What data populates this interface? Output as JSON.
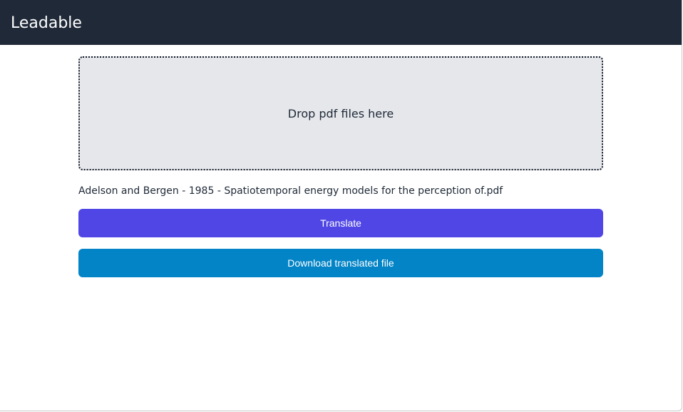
{
  "app": {
    "title": "Leadable"
  },
  "dropzone": {
    "label": "Drop pdf files here"
  },
  "file": {
    "name": "Adelson and Bergen - 1985 - Spatiotemporal energy models for the perception of.pdf"
  },
  "actions": {
    "translate_label": "Translate",
    "download_label": "Download translated file"
  },
  "colors": {
    "navbar": "#1f2937",
    "dropzone_bg": "#e5e7eb",
    "translate_button": "#4f46e5",
    "download_button": "#0284c7"
  }
}
